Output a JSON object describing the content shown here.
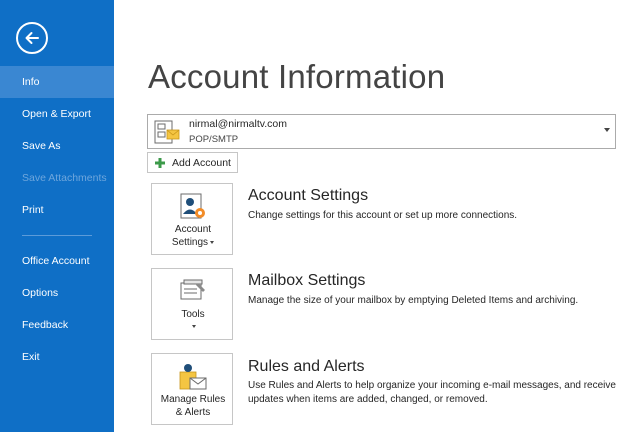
{
  "sidebar": {
    "items": [
      {
        "label": "Info"
      },
      {
        "label": "Open & Export"
      },
      {
        "label": "Save As"
      },
      {
        "label": "Save Attachments"
      },
      {
        "label": "Print"
      },
      {
        "label": "Office Account"
      },
      {
        "label": "Options"
      },
      {
        "label": "Feedback"
      },
      {
        "label": "Exit"
      }
    ],
    "active": "Info",
    "disabled": [
      "Save Attachments"
    ]
  },
  "page": {
    "title": "Account Information"
  },
  "account": {
    "email": "nirmal@nirmaltv.com",
    "type": "POP/SMTP"
  },
  "add_account_label": "Add Account",
  "sections": [
    {
      "tile_line1": "Account",
      "tile_line2": "Settings",
      "title": "Account Settings",
      "description": "Change settings for this account or set up more connections."
    },
    {
      "tile_line1": "Tools",
      "title": "Mailbox Settings",
      "description": "Manage the size of your mailbox by emptying Deleted Items and archiving."
    },
    {
      "tile_line1": "Manage Rules",
      "tile_line2": "& Alerts",
      "title": "Rules and Alerts",
      "description": "Use Rules and Alerts to help organize your incoming e-mail messages, and receive updates when items are added, changed, or removed."
    }
  ],
  "colors": {
    "sidebar": "#0f6fc6",
    "sidebar_active": "#3a87d2",
    "disabled_text": "#6ea6dc",
    "add_icon": "#3c9a4a",
    "settings_icon": "#f28c28"
  }
}
